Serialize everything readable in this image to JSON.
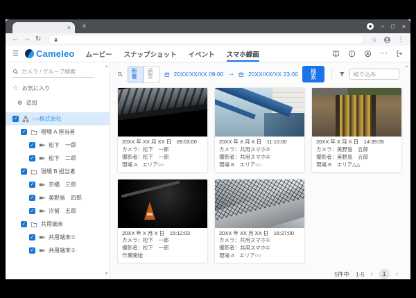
{
  "browser": {
    "tab_close": "×",
    "new_tab": "+",
    "minimize": "−",
    "maximize": "□",
    "close": "×",
    "back": "←",
    "forward": "→",
    "reload": "↻",
    "bookmark_star": "☆",
    "menu_dots": "⋮"
  },
  "header": {
    "menu_glyph": "☰",
    "logo_text": "Cameleo",
    "nav": [
      {
        "label": "ムービー"
      },
      {
        "label": "スナップショット"
      },
      {
        "label": "イベント"
      },
      {
        "label": "スマホ録画"
      }
    ],
    "more_glyph": "⋯"
  },
  "sidebar": {
    "search_placeholder": "カメラ / グループ検索",
    "favorites_star": "☆",
    "favorites": "お気に入り",
    "add_glyph": "⊕",
    "add": "追加",
    "check": "✓",
    "scroll_up": "▲",
    "scroll_down": "▼",
    "tree": [
      {
        "label": "○○株式会社"
      },
      {
        "label": "現場 A 担当者"
      },
      {
        "label": "松下　一郎"
      },
      {
        "label": "松下　二郎"
      },
      {
        "label": "現場 B 担当者"
      },
      {
        "label": "京橋　三郎"
      },
      {
        "label": "美野島　四郎"
      },
      {
        "label": "汐留　五郎"
      },
      {
        "label": "共用端末"
      },
      {
        "label": "共用端末①"
      },
      {
        "label": "共用端末②"
      }
    ]
  },
  "toolbar": {
    "mode_new": "新着",
    "mode_past": "過去",
    "date_from": "20XX/XX/XX 09:00",
    "date_arrow": "→",
    "date_to": "20XX/XX/XX 23:00",
    "search_label": "検索",
    "filter_placeholder": "絞り込み",
    "scroll_up": "▲"
  },
  "cards": [
    {
      "timestamp": "20XX 年 XX 月 XX 日　09:03:00",
      "camera": "カメラ：松下　一郎",
      "photographer": "撮影者：松下　一郎",
      "note": "現場 A　エリア○○"
    },
    {
      "timestamp": "20XX 年 X 月 X 日　11:10:00",
      "camera": "カメラ：共用スマホ②",
      "photographer": "撮影者：共用スマホ②",
      "note": "現場 B　エリア○○"
    },
    {
      "timestamp": "20XX 年 X 月 X 日　14:39:05",
      "camera": "カメラ：美野島　五郎",
      "photographer": "撮影者：美野島　五郎",
      "note": "現場 B　エリア△△"
    },
    {
      "timestamp": "20XX 年 X 月 X 日　15:12:03",
      "camera": "カメラ：松下　一郎",
      "photographer": "撮影者：松下　一郎",
      "note": "作業開始"
    },
    {
      "timestamp": "20XX 年 XX 月 XX 日　16:27:00",
      "camera": "カメラ：共用スマホ①",
      "photographer": "撮影者：共用スマホ①",
      "note": "現場 A　エリア○○"
    }
  ],
  "pagination": {
    "total": "5件中",
    "range": "1-5",
    "prev": "‹",
    "page": "1",
    "next": "›"
  },
  "colors": {
    "accent": "#1a73e8",
    "logo_blue": "#1e88e5",
    "checkbox_blue": "#1976d2",
    "selected_row_bg": "#dbeafb"
  }
}
